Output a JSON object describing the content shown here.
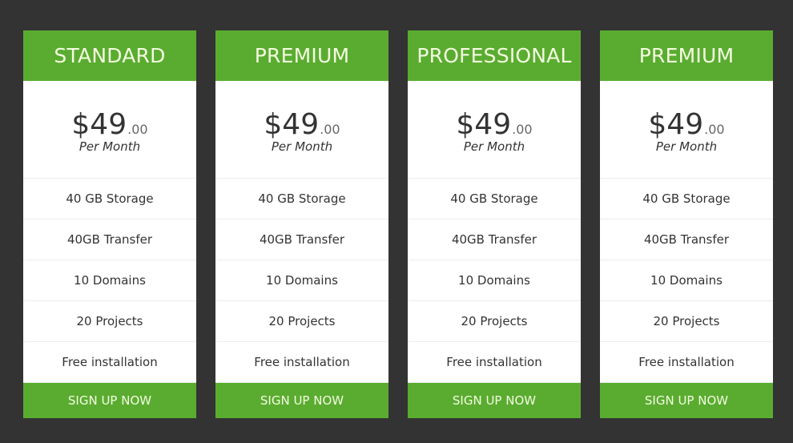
{
  "theme": {
    "accent": "#5aac30",
    "background": "#333333",
    "card": "#ffffff"
  },
  "plans": [
    {
      "name": "STANDARD",
      "price": "$49",
      "cents": ".00",
      "period": "Per Month",
      "features": [
        "40 GB Storage",
        "40GB Transfer",
        "10 Domains",
        "20 Projects",
        "Free installation"
      ],
      "cta": "SIGN UP NOW"
    },
    {
      "name": "PREMIUM",
      "price": "$49",
      "cents": ".00",
      "period": "Per Month",
      "features": [
        "40 GB Storage",
        "40GB Transfer",
        "10 Domains",
        "20 Projects",
        "Free installation"
      ],
      "cta": "SIGN UP NOW"
    },
    {
      "name": "PROFESSIONAL",
      "price": "$49",
      "cents": ".00",
      "period": "Per Month",
      "features": [
        "40 GB Storage",
        "40GB Transfer",
        "10 Domains",
        "20 Projects",
        "Free installation"
      ],
      "cta": "SIGN UP NOW"
    },
    {
      "name": "PREMIUM",
      "price": "$49",
      "cents": ".00",
      "period": "Per Month",
      "features": [
        "40 GB Storage",
        "40GB Transfer",
        "10 Domains",
        "20 Projects",
        "Free installation"
      ],
      "cta": "SIGN UP NOW"
    }
  ]
}
